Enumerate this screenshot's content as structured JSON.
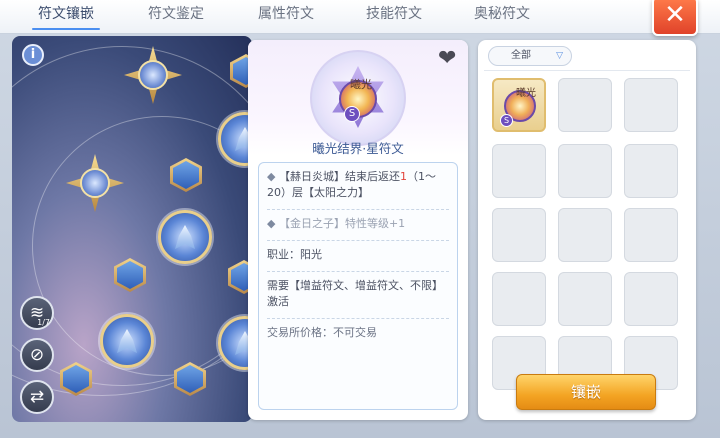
{
  "tabs": [
    {
      "label": "符文镶嵌",
      "active": true
    },
    {
      "label": "符文鉴定",
      "active": false
    },
    {
      "label": "属性符文",
      "active": false
    },
    {
      "label": "技能符文",
      "active": false
    },
    {
      "label": "奥秘符文",
      "active": false
    }
  ],
  "close": {
    "glyph": "✕"
  },
  "tree": {
    "info_glyph": "i",
    "side_buttons": [
      {
        "glyph": "≋",
        "badge": "1/7"
      },
      {
        "glyph": "⊘",
        "badge": ""
      },
      {
        "glyph": "⇄",
        "badge": ""
      }
    ]
  },
  "detail": {
    "art_text": "曦光",
    "seal_glyph": "S",
    "name": "曦光结界·星符文",
    "line1_pre": "【赫日炎城】结束后返还",
    "line1_red": "1",
    "line1_post": "（1～20）层【太阳之力】",
    "line2": "【金日之子】特性等级+1",
    "job": "职业：阳光",
    "require": "需要【增益符文、增益符文、不限】激活",
    "trade": "交易所价格：不可交易"
  },
  "inventory": {
    "filter_label": "全部",
    "filter_chevron": "▽",
    "item_text": "曦光",
    "seal_glyph": "S",
    "embed_label": "镶嵌"
  },
  "colors": {
    "accent": "#4a8ef0",
    "close": "#e0432a",
    "embed": "#f3a423",
    "highlight": "#e2433a"
  }
}
